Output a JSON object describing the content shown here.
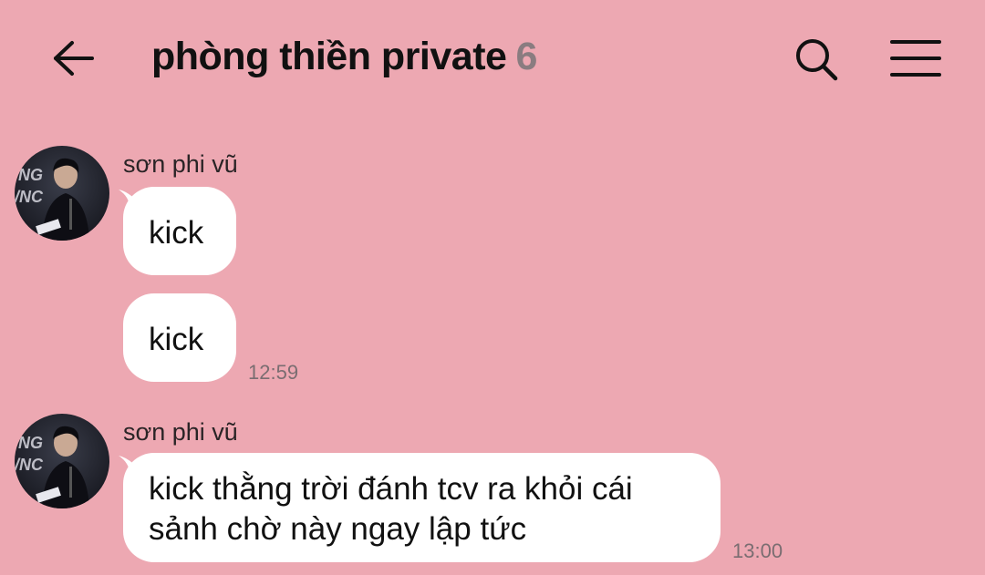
{
  "header": {
    "back_icon": "arrow-left-icon",
    "title": "phòng thiền private",
    "member_count": "6",
    "search_icon": "search-icon",
    "menu_icon": "hamburger-menu-icon"
  },
  "colors": {
    "background": "#eda8b2",
    "bubble": "#ffffff",
    "count": "#8a7c80"
  },
  "messages": [
    {
      "sender": "sơn phi vũ",
      "bubbles": [
        {
          "text": "kick"
        },
        {
          "text": "kick",
          "time": "12:59"
        }
      ]
    },
    {
      "sender": "sơn phi vũ",
      "bubbles": [
        {
          "text": "kick thằng trời đánh tcv ra khỏi cái sảnh chờ này ngay lập tức",
          "line1": "kick thằng trời đánh tcv ra khỏi cái",
          "line2": "sảnh chờ này ngay lập tức",
          "time": "13:00"
        }
      ]
    }
  ]
}
